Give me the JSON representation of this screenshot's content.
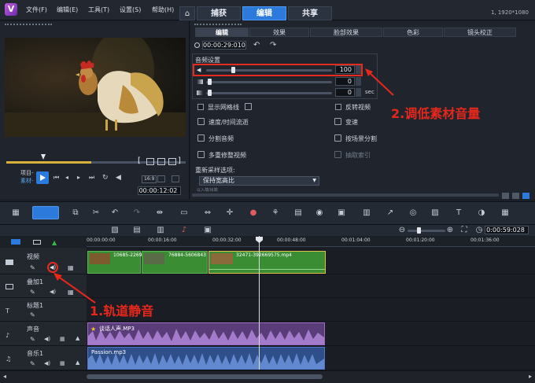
{
  "app": {
    "logo_letter": "V",
    "menu": [
      "文件(F)",
      "编辑(E)",
      "工具(T)",
      "设置(S)",
      "帮助(H)"
    ],
    "tabs": [
      {
        "label": "捕获"
      },
      {
        "label": "编辑",
        "active": true
      },
      {
        "label": "共享"
      }
    ],
    "project_info": "1, 1920*1080"
  },
  "player": {
    "mode_labels": {
      "project": "项目-",
      "clip": "素材-"
    },
    "timecode": "00:00:12:02",
    "aspect": "16:9",
    "bracket_in": "[",
    "bracket_out": "]"
  },
  "options_panel": {
    "time": "00:00:29:010",
    "tabs": [
      "编辑",
      "效果",
      "脸部效果",
      "色彩",
      "镜头校正"
    ],
    "audio_settings_label": "音频设置",
    "volume_value": "100",
    "fade_in_value": "0",
    "fade_out_value": "0",
    "sec_unit": "sec",
    "options": [
      {
        "label": "显示网格线",
        "checkbox": true
      },
      {
        "label": "速度/时间流逝"
      },
      {
        "label": "分割音频"
      },
      {
        "label": "多重修整视频"
      },
      {
        "label": "反转视频",
        "checkbox": true
      },
      {
        "label": "变速"
      },
      {
        "label": "按场景分割"
      },
      {
        "label": "抽取索引"
      }
    ],
    "resample_label": "重新采样选项:",
    "resample_value": "保持宽高比",
    "resample_hint": "以入端/出端"
  },
  "annotations": {
    "step1": "1.轨道静音",
    "step2": "2.调低素材音量"
  },
  "timeline": {
    "zoom_time": "0:00:59:028",
    "ruler_ticks": [
      "00:00:00:00",
      "00:00:16:00",
      "00:00:32:00",
      "00:00:48:00",
      "00:01:04:00",
      "00:01:20:00",
      "00:01:36:00"
    ],
    "tracks": [
      {
        "name": "视频"
      },
      {
        "name": "叠加1"
      },
      {
        "name": "标题1"
      },
      {
        "name": "声音"
      },
      {
        "name": "音乐1"
      }
    ],
    "clips": {
      "video": [
        "10685-2269",
        "76884-5606843",
        "32471-392669575.mp4"
      ],
      "voice": "谈话人声.MP3",
      "music": "Passion.mp3"
    }
  },
  "colors": {
    "accent": "#2c7bdc",
    "annotation": "#e8271c",
    "video_clip": "#3b8d34",
    "voice_clip": "#9c6ac7",
    "music_clip": "#4f79c8"
  }
}
